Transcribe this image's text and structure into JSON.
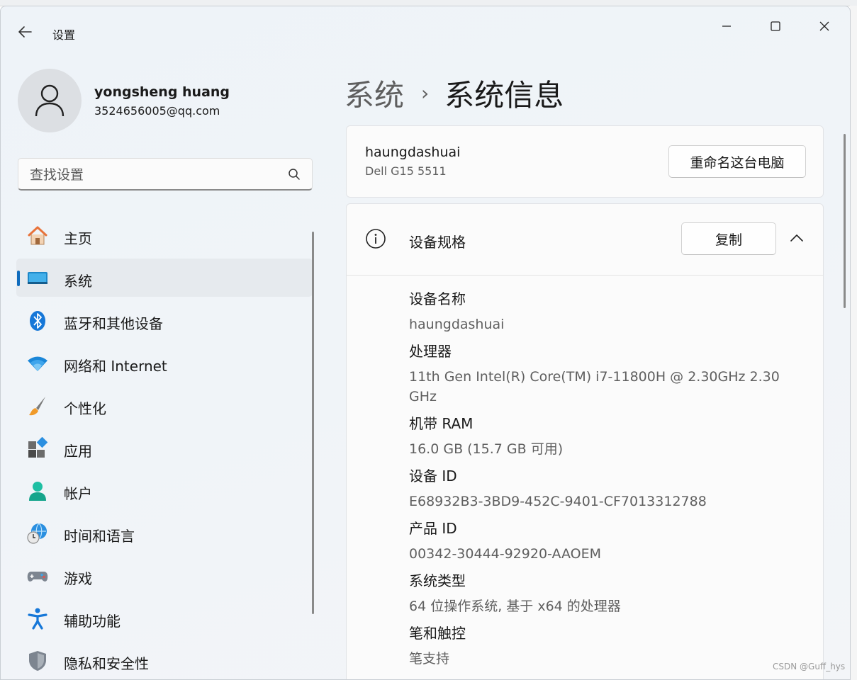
{
  "window": {
    "app_title": "设置",
    "controls": [
      "minimize",
      "maximize",
      "close"
    ]
  },
  "user": {
    "name": "yongsheng huang",
    "email": "3524656005@qq.com"
  },
  "search": {
    "placeholder": "查找设置",
    "value": ""
  },
  "sidebar": {
    "items": [
      {
        "label": "主页",
        "icon": "home-icon",
        "active": false
      },
      {
        "label": "系统",
        "icon": "system-icon",
        "active": true
      },
      {
        "label": "蓝牙和其他设备",
        "icon": "bluetooth-icon",
        "active": false
      },
      {
        "label": "网络和 Internet",
        "icon": "wifi-icon",
        "active": false
      },
      {
        "label": "个性化",
        "icon": "brush-icon",
        "active": false
      },
      {
        "label": "应用",
        "icon": "apps-icon",
        "active": false
      },
      {
        "label": "帐户",
        "icon": "account-icon",
        "active": false
      },
      {
        "label": "时间和语言",
        "icon": "globe-clock-icon",
        "active": false
      },
      {
        "label": "游戏",
        "icon": "gamepad-icon",
        "active": false
      },
      {
        "label": "辅助功能",
        "icon": "accessibility-icon",
        "active": false
      },
      {
        "label": "隐私和安全性",
        "icon": "shield-icon",
        "active": false
      }
    ]
  },
  "breadcrumb": {
    "parent": "系统",
    "separator": "›",
    "current": "系统信息"
  },
  "pc": {
    "name": "haungdashuai",
    "model": "Dell G15 5511",
    "rename_label": "重命名这台电脑"
  },
  "specs": {
    "title": "设备规格",
    "copy_label": "复制",
    "expanded": true,
    "rows": [
      {
        "label": "设备名称",
        "value": "haungdashuai"
      },
      {
        "label": "处理器",
        "value": "11th Gen Intel(R) Core(TM) i7-11800H @ 2.30GHz   2.30 GHz"
      },
      {
        "label": "机带 RAM",
        "value": "16.0 GB (15.7 GB 可用)"
      },
      {
        "label": "设备 ID",
        "value": "E68932B3-3BD9-452C-9401-CF7013312788"
      },
      {
        "label": "产品 ID",
        "value": "00342-30444-92920-AAOEM"
      },
      {
        "label": "系统类型",
        "value": "64 位操作系统, 基于 x64 的处理器"
      },
      {
        "label": "笔和触控",
        "value": "笔支持"
      }
    ]
  },
  "watermark": "CSDN @Guff_hys",
  "colors": {
    "accent": "#0f6cbd",
    "window_bg": "#eef3f8",
    "card_bg": "#fbfbfb",
    "secondary_text": "#5f5f5f"
  }
}
